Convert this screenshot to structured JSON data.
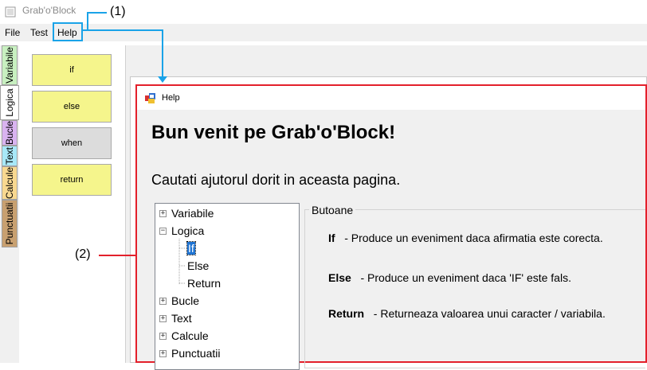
{
  "window": {
    "title": "Grab'o'Block"
  },
  "menu": {
    "file": "File",
    "test": "Test",
    "help": "Help"
  },
  "annotations": {
    "callout_1": "(1)",
    "callout_2": "(2)",
    "highlight_color": "#1aa3e8",
    "box_color": "#e3202b"
  },
  "tabs": [
    {
      "label": "Variabile",
      "color": "#c8f0c0"
    },
    {
      "label": "Logica",
      "color": "#ffffff",
      "active": true
    },
    {
      "label": "Bucle",
      "color": "#d9b3f0"
    },
    {
      "label": "Text",
      "color": "#a8e8f8"
    },
    {
      "label": "Calcule",
      "color": "#f8d890"
    },
    {
      "label": "Punctuatii",
      "color": "#c8a070"
    }
  ],
  "blocks": [
    {
      "label": "if",
      "color": "#f5f58c"
    },
    {
      "label": "else",
      "color": "#f5f58c"
    },
    {
      "label": "when",
      "color": "#dcdcdc"
    },
    {
      "label": "return",
      "color": "#f5f58c"
    }
  ],
  "help": {
    "window_title": "Help",
    "heading": "Bun venit pe Grab'o'Block!",
    "subtitle": "Cautati ajutorul dorit in aceasta pagina.",
    "tree": {
      "variabile": "Variabile",
      "logica": "Logica",
      "if": "If",
      "else": "Else",
      "return": "Return",
      "bucle": "Bucle",
      "text": "Text",
      "calcule": "Calcule",
      "punctuatii": "Punctuatii"
    },
    "group_title": "Butoane",
    "items": [
      {
        "name": "If",
        "text": "- Produce un eveniment daca afirmatia este corecta."
      },
      {
        "name": "Else",
        "text": "- Produce un eveniment daca 'IF' este fals."
      },
      {
        "name": "Return",
        "text": "- Returneaza valoarea unui caracter / variabila."
      }
    ]
  }
}
